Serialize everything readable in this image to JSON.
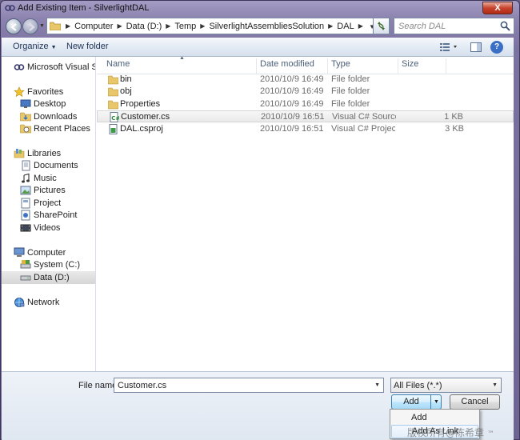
{
  "window": {
    "title": "Add Existing Item - SilverlightDAL",
    "close_label": "X"
  },
  "address_bar": {
    "breadcrumbs": [
      "Computer",
      "Data (D:)",
      "Temp",
      "SilverlightAssembliesSolution",
      "DAL"
    ],
    "search_placeholder": "Search DAL"
  },
  "toolbar": {
    "organize_label": "Organize",
    "new_folder_label": "New folder",
    "help_label": "?"
  },
  "nav_pane": {
    "items": [
      {
        "label": "Microsoft Visual Studi",
        "icon": "visual-studio-icon"
      },
      {
        "label": "Favorites",
        "icon": "star-icon"
      },
      {
        "label": "Desktop",
        "icon": "desktop-icon"
      },
      {
        "label": "Downloads",
        "icon": "downloads-icon"
      },
      {
        "label": "Recent Places",
        "icon": "recent-places-icon"
      },
      {
        "label": "Libraries",
        "icon": "libraries-icon"
      },
      {
        "label": "Documents",
        "icon": "documents-icon"
      },
      {
        "label": "Music",
        "icon": "music-icon"
      },
      {
        "label": "Pictures",
        "icon": "pictures-icon"
      },
      {
        "label": "Project",
        "icon": "project-icon"
      },
      {
        "label": "SharePoint",
        "icon": "sharepoint-icon"
      },
      {
        "label": "Videos",
        "icon": "videos-icon"
      },
      {
        "label": "Computer",
        "icon": "computer-icon"
      },
      {
        "label": "System (C:)",
        "icon": "drive-icon"
      },
      {
        "label": "Data (D:)",
        "icon": "drive-icon",
        "selected": true
      },
      {
        "label": "Network",
        "icon": "network-icon"
      }
    ]
  },
  "file_list": {
    "columns": [
      "Name",
      "Date modified",
      "Type",
      "Size"
    ],
    "rows": [
      {
        "name": "bin",
        "date": "2010/10/9 16:49",
        "type": "File folder",
        "size": "",
        "icon": "folder-icon"
      },
      {
        "name": "obj",
        "date": "2010/10/9 16:49",
        "type": "File folder",
        "size": "",
        "icon": "folder-icon"
      },
      {
        "name": "Properties",
        "date": "2010/10/9 16:49",
        "type": "File folder",
        "size": "",
        "icon": "folder-icon"
      },
      {
        "name": "Customer.cs",
        "date": "2010/10/9 16:51",
        "type": "Visual C# Source f...",
        "size": "1 KB",
        "icon": "csharp-file-icon",
        "selected": true
      },
      {
        "name": "DAL.csproj",
        "date": "2010/10/9 16:51",
        "type": "Visual C# Project f...",
        "size": "3 KB",
        "icon": "csproj-file-icon"
      }
    ]
  },
  "bottom": {
    "file_name_label": "File name:",
    "file_name_value": "Customer.cs",
    "filter_value": "All Files (*.*)",
    "add_label": "Add",
    "cancel_label": "Cancel"
  },
  "add_menu": {
    "items": [
      "Add",
      "Add As Link"
    ]
  },
  "watermark": {
    "text": "版权所有@陈希章",
    "tm": "™"
  },
  "colors": {
    "frame": "#7b729f",
    "toolbar": "#e3ebf4",
    "accent": "#3c7fb1"
  }
}
